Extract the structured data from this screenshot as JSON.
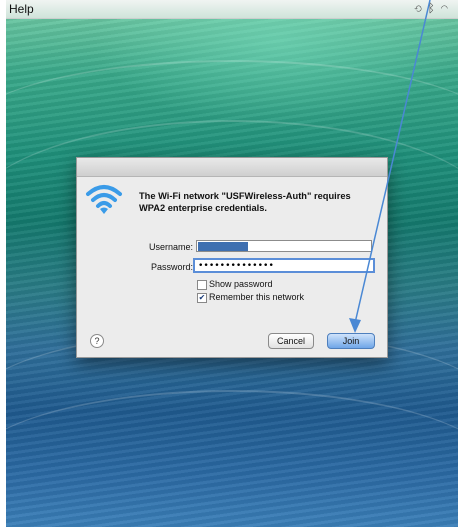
{
  "menubar": {
    "help_label": "Help",
    "icons": [
      "time-machine-icon",
      "bluetooth-icon",
      "wifi-icon"
    ]
  },
  "dialog": {
    "message": "The Wi-Fi network \"USFWireless-Auth\" requires WPA2 enterprise credentials.",
    "username_label": "Username:",
    "username_value": "",
    "password_label": "Password:",
    "password_value": "••••••••••••••",
    "show_password_label": "Show password",
    "show_password_checked": false,
    "remember_label": "Remember this network",
    "remember_checked": true,
    "help_label": "?",
    "cancel_label": "Cancel",
    "join_label": "Join"
  },
  "colors": {
    "accent": "#5b8ed8",
    "annotation_arrow": "#4a88d4"
  }
}
